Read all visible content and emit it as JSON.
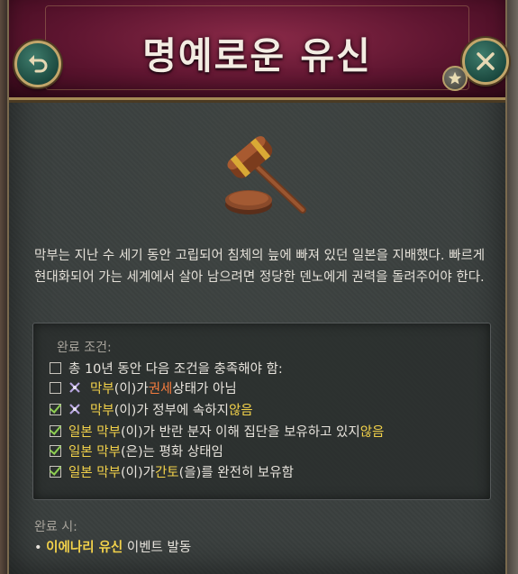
{
  "header": {
    "title": "명예로운 유신"
  },
  "description": "막부는 지난 수 세기 동안 고립되어 침체의 늪에 빠져 있던 일본을 지배했다. 빠르게 현대화되어 가는 세계에서 살아 남으려면 정당한 덴노에게 권력을 돌려주어야 한다.",
  "conditions": {
    "title": "완료 조건:",
    "rows": [
      {
        "checked": false,
        "parts": [
          "총 10년 동안 다음 조건을 충족해야 함:"
        ]
      },
      {
        "checked": false,
        "flag": true,
        "parts": [
          "막부",
          "(이)가 ",
          "권세",
          " 상태가 아님"
        ]
      },
      {
        "checked": true,
        "flag": true,
        "parts": [
          "막부",
          "(이)가 정부에 속하지 ",
          "않음"
        ]
      },
      {
        "checked": true,
        "parts": [
          "일본 막부",
          "(이)가 반란 분자 이해 집단을 보유하고 있지 ",
          "않음"
        ]
      },
      {
        "checked": true,
        "parts": [
          "일본 막부",
          "(은)는 평화 상태임"
        ]
      },
      {
        "checked": true,
        "parts": [
          "일본 막부",
          "(이)가 ",
          "간토",
          "(을)를 완전히 보유함"
        ]
      }
    ]
  },
  "completion": {
    "title": "완료 시:",
    "bullet": "•",
    "event_name": "이에나리 유신",
    "event_suffix": " 이벤트 발동"
  },
  "icons": {
    "back": "undo-arrow-icon",
    "close": "close-x-icon",
    "favorite": "star-icon",
    "image": "gavel-icon",
    "flag": "shogunate-crossed-swords-icon"
  },
  "colors": {
    "highlight_yellow": "#f3d24a",
    "highlight_orange": "#f47c3e",
    "check_green": "#8ecf52"
  }
}
